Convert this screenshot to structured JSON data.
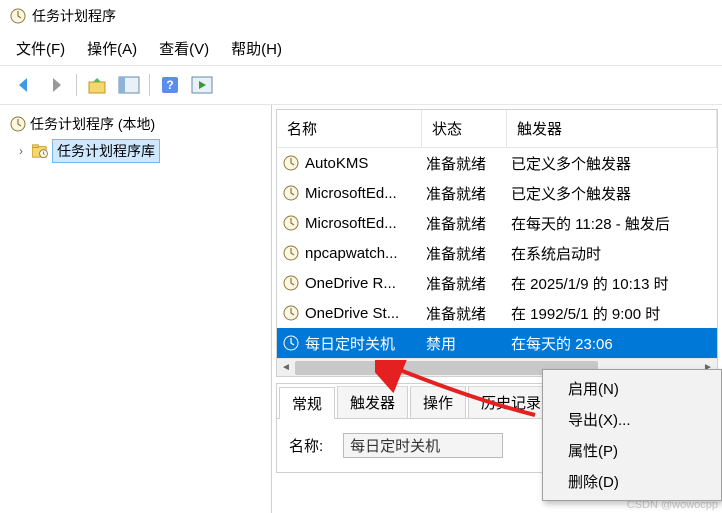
{
  "title": "任务计划程序",
  "menus": {
    "file": "文件(F)",
    "action": "操作(A)",
    "view": "查看(V)",
    "help": "帮助(H)"
  },
  "tree": {
    "root": "任务计划程序 (本地)",
    "library": "任务计划程序库"
  },
  "columns": {
    "name": "名称",
    "status": "状态",
    "trigger": "触发器"
  },
  "tasks": [
    {
      "name": "AutoKMS",
      "status": "准备就绪",
      "trigger": "已定义多个触发器"
    },
    {
      "name": "MicrosoftEd...",
      "status": "准备就绪",
      "trigger": "已定义多个触发器"
    },
    {
      "name": "MicrosoftEd...",
      "status": "准备就绪",
      "trigger": "在每天的 11:28 - 触发后"
    },
    {
      "name": "npcapwatch...",
      "status": "准备就绪",
      "trigger": "在系统启动时"
    },
    {
      "name": "OneDrive R...",
      "status": "准备就绪",
      "trigger": "在 2025/1/9 的 10:13 时"
    },
    {
      "name": "OneDrive St...",
      "status": "准备就绪",
      "trigger": "在 1992/5/1 的 9:00 时"
    },
    {
      "name": "每日定时关机",
      "status": "禁用",
      "trigger": "在每天的 23:06"
    }
  ],
  "context_menu": {
    "enable": "启用(N)",
    "export": "导出(X)...",
    "properties": "属性(P)",
    "delete": "删除(D)"
  },
  "tabs": {
    "general": "常规",
    "triggers": "触发器",
    "actions": "操作",
    "history": "历史记录"
  },
  "detail": {
    "name_label": "名称:",
    "name_value": "每日定时关机"
  },
  "watermark": "CSDN @wowocpp"
}
